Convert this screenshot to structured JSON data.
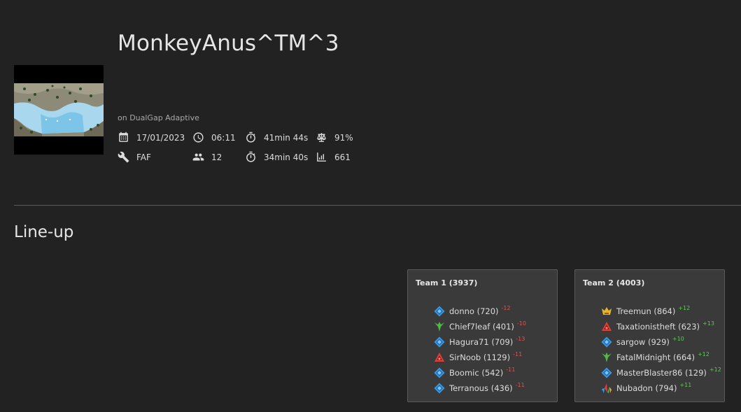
{
  "game": {
    "title": "MonkeyAnus^TM^3",
    "map_line": "on DualGap Adaptive"
  },
  "stats": {
    "date": {
      "icon": "calendar-icon",
      "value": "17/01/2023"
    },
    "time": {
      "icon": "clock-icon",
      "value": "06:11"
    },
    "duration": {
      "icon": "stopwatch-icon",
      "value": "41min 44s"
    },
    "balance": {
      "icon": "scale-icon",
      "value": "91%"
    },
    "featured_mod": {
      "icon": "wrench-icon",
      "value": "FAF"
    },
    "players": {
      "icon": "people-icon",
      "value": "12"
    },
    "replay_duration": {
      "icon": "stopwatch-icon",
      "value": "34min 40s"
    },
    "rating": {
      "icon": "bar-chart-icon",
      "value": "661"
    }
  },
  "lineup": {
    "title": "Line-up",
    "teams": [
      {
        "title": "Team 1 (3937)",
        "players": [
          {
            "faction": "uef",
            "name": "donno (720)",
            "delta": "-12"
          },
          {
            "faction": "seraphim",
            "name": "Chief7leaf (401)",
            "delta": "-10"
          },
          {
            "faction": "uef",
            "name": "Hagura71 (709)",
            "delta": "-13"
          },
          {
            "faction": "cybran",
            "name": "SirNoob (1129)",
            "delta": "-11"
          },
          {
            "faction": "uef",
            "name": "Boomic (542)",
            "delta": "-11"
          },
          {
            "faction": "uef",
            "name": "Terranous (436)",
            "delta": "-11"
          }
        ]
      },
      {
        "title": "Team 2 (4003)",
        "players": [
          {
            "faction": "aeon",
            "name": "Treemun (864)",
            "delta": "+12"
          },
          {
            "faction": "cybran",
            "name": "Taxationistheft (623)",
            "delta": "+13"
          },
          {
            "faction": "uef",
            "name": "sargow (929)",
            "delta": "+10"
          },
          {
            "faction": "seraphim",
            "name": "FatalMidnight (664)",
            "delta": "+12"
          },
          {
            "faction": "uef",
            "name": "MasterBlaster86 (129)",
            "delta": "+12"
          },
          {
            "faction": "random",
            "name": "Nubadon (794)",
            "delta": "+11"
          }
        ]
      }
    ]
  },
  "colors": {
    "background": "#222222",
    "panel": "#3a3a3a",
    "negative": "#e55050",
    "positive": "#63c75b",
    "uef": "#3a9ae8",
    "cybran": "#e0403a",
    "seraphim": "#52b848",
    "aeon": "#e8b42a"
  }
}
